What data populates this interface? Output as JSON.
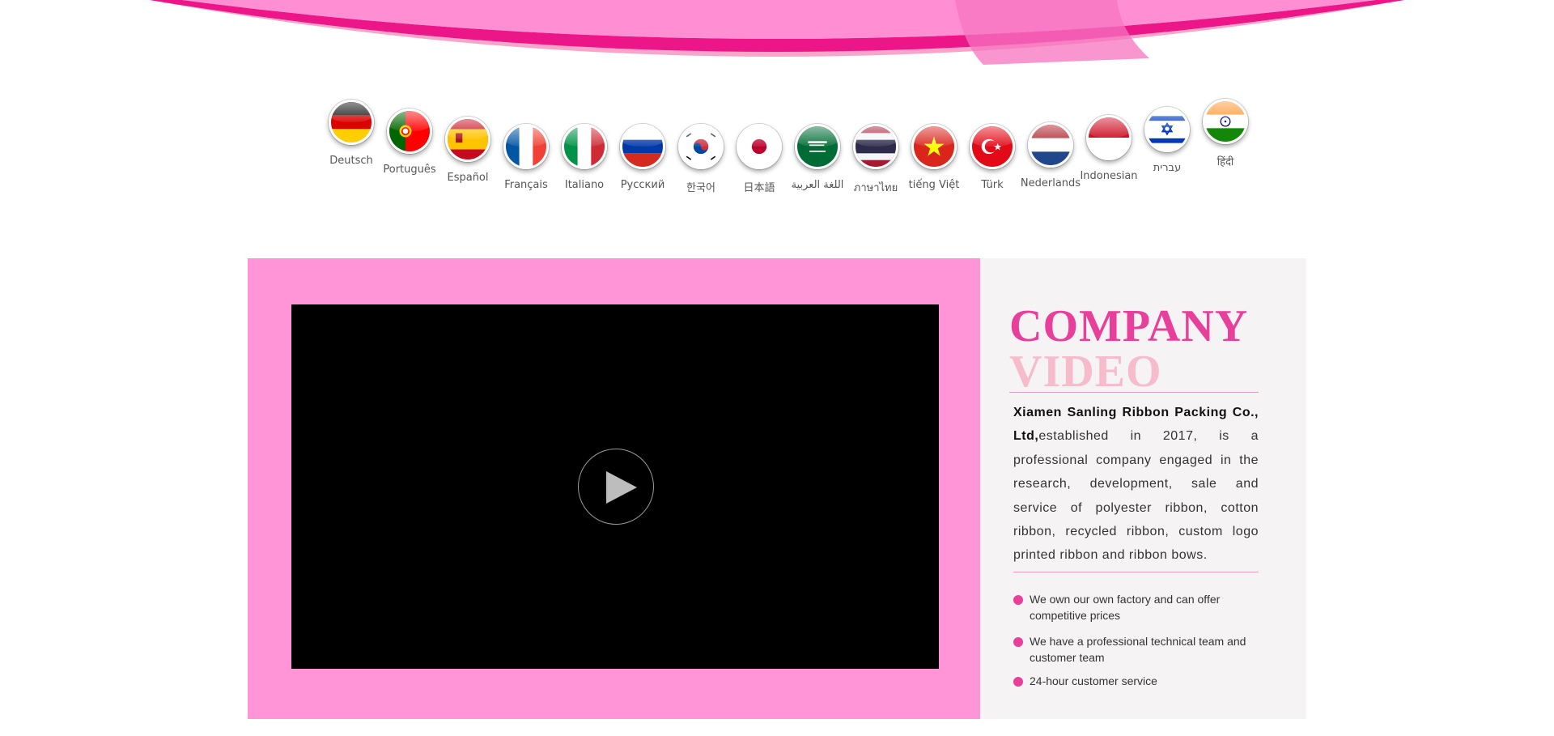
{
  "languages": [
    {
      "label": "Deutsch",
      "flag": "de"
    },
    {
      "label": "Português",
      "flag": "pt"
    },
    {
      "label": "Español",
      "flag": "es"
    },
    {
      "label": "Français",
      "flag": "fr"
    },
    {
      "label": "Italiano",
      "flag": "it"
    },
    {
      "label": "Русский",
      "flag": "ru"
    },
    {
      "label": "한국어",
      "flag": "kr"
    },
    {
      "label": "日本語",
      "flag": "jp"
    },
    {
      "label": "اللغة العربية",
      "flag": "sa"
    },
    {
      "label": "ภาษาไทย",
      "flag": "th"
    },
    {
      "label": "tiếng Việt",
      "flag": "vn"
    },
    {
      "label": "Türk",
      "flag": "tr"
    },
    {
      "label": "Nederlands",
      "flag": "nl"
    },
    {
      "label": "Indonesian",
      "flag": "id"
    },
    {
      "label": "עברית",
      "flag": "il"
    },
    {
      "label": "हिंदी",
      "flag": "in"
    }
  ],
  "company": {
    "title_line1": "COMPANY",
    "title_line2": "VIDEO",
    "name": "Xiamen Sanling Ribbon Packing Co., Ltd,",
    "description": "established in 2017, is a professional company engaged in the research, development, sale and service of polyester ribbon, cotton ribbon, recycled ribbon, custom logo printed ribbon and ribbon bows.",
    "features": [
      "We own our own factory and can offer competitive prices",
      "We have a professional technical team and customer team",
      "24-hour customer service"
    ]
  },
  "colors": {
    "brand_pink": "#e8409a",
    "panel_pink": "#ff95d6",
    "title_light_pink": "#f7bccb",
    "info_bg": "#f5f3f4",
    "video_bg": "#000000"
  }
}
